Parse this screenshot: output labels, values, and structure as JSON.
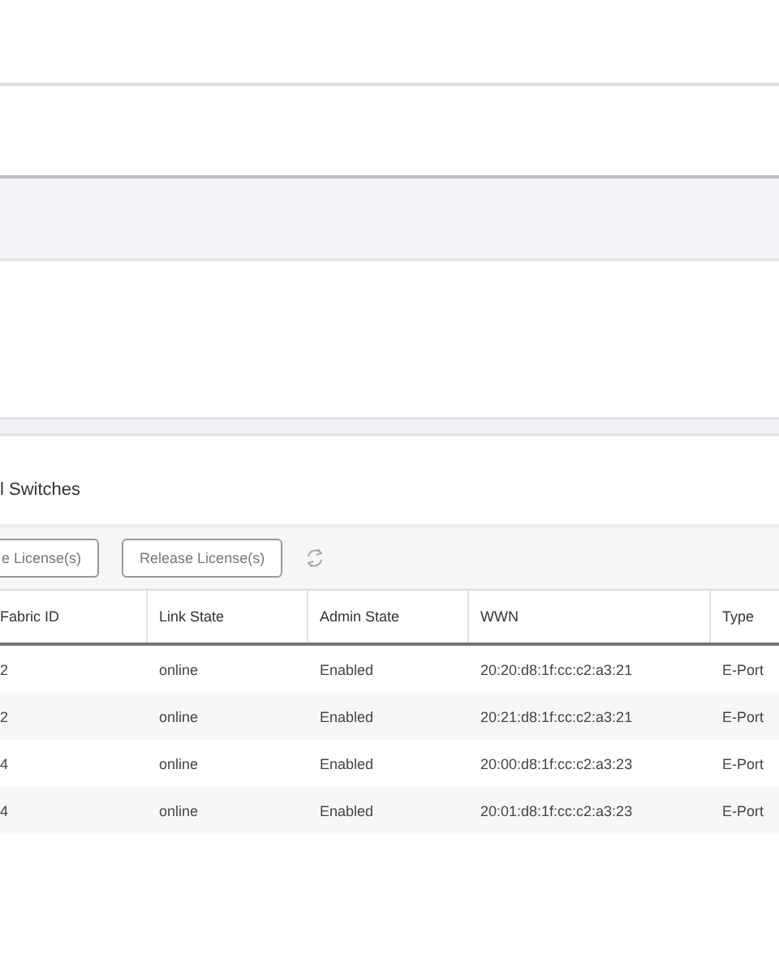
{
  "section_title": "l Switches",
  "toolbar": {
    "buttons": [
      {
        "label": "e License(s)",
        "disabled": true
      },
      {
        "label": "Release License(s)",
        "disabled": true
      }
    ]
  },
  "table": {
    "columns": [
      "Fabric ID",
      "Link State",
      "Admin State",
      "WWN",
      "Type"
    ],
    "rows": [
      [
        "2",
        "online",
        "Enabled",
        "20:20:d8:1f:cc:c2:a3:21",
        "E-Port"
      ],
      [
        "2",
        "online",
        "Enabled",
        "20:21:d8:1f:cc:c2:a3:21",
        "E-Port"
      ],
      [
        "4",
        "online",
        "Enabled",
        "20:00:d8:1f:cc:c2:a3:23",
        "E-Port"
      ],
      [
        "4",
        "online",
        "Enabled",
        "20:01:d8:1f:cc:c2:a3:23",
        "E-Port"
      ]
    ]
  }
}
